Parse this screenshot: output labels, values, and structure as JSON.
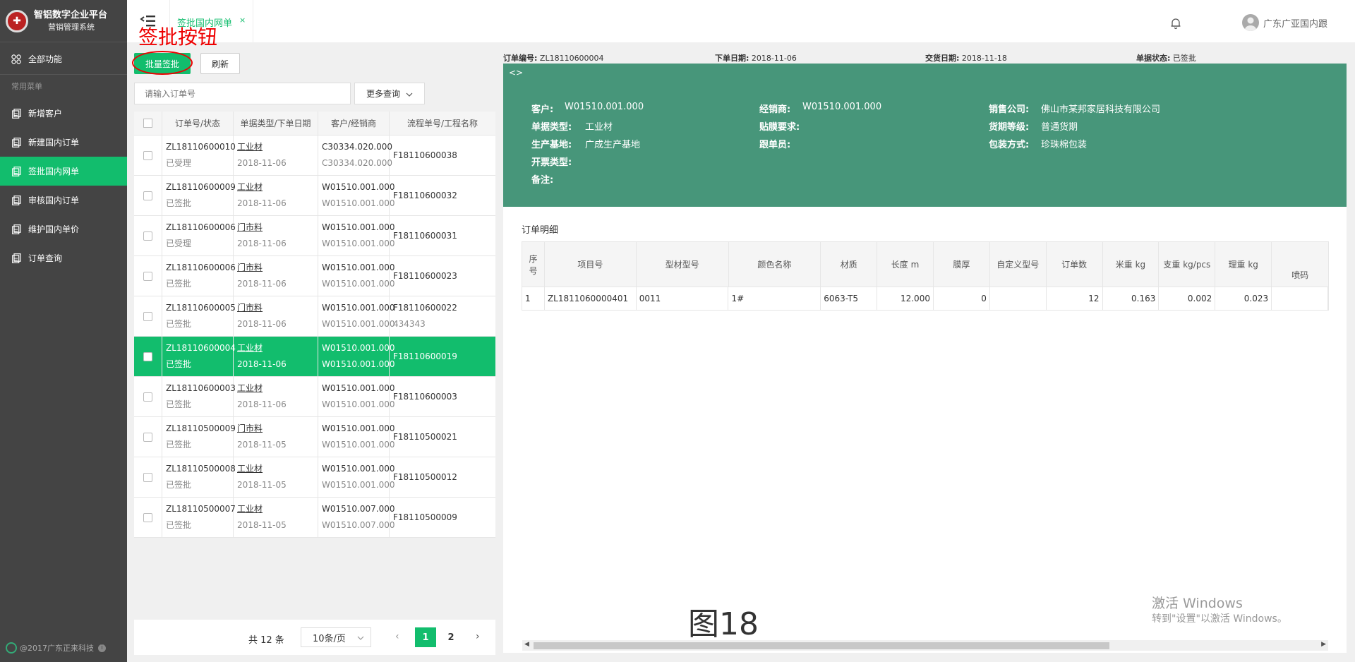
{
  "brand": {
    "title": "智铝数字企业平台",
    "subtitle": "营销管理系统",
    "logo_icon": "company-seal-logo"
  },
  "sidebar": {
    "all_label": "全部功能",
    "section_label": "常用菜单",
    "items": [
      {
        "label": "新增客户"
      },
      {
        "label": "新建国内订单"
      },
      {
        "label": "签批国内网单"
      },
      {
        "label": "审核国内订单"
      },
      {
        "label": "维护国内单价"
      },
      {
        "label": "订单查询"
      }
    ],
    "active_index": 2,
    "footer": "@2017广东正来科技"
  },
  "topbar": {
    "tab_label": "签批国内网单",
    "tab_close": "×",
    "user_name": "广东广亚国内跟"
  },
  "annotation": "签批按钮",
  "toolbar": {
    "batch_sign_label": "批量签批",
    "refresh_label": "刷新",
    "search_placeholder": "请输入订单号",
    "more_query_label": "更多查询"
  },
  "order_list": {
    "headers": [
      "订单号/状态",
      "单据类型/下单日期",
      "客户/经销商",
      "流程单号/工程名称"
    ],
    "rows": [
      {
        "order": "ZL18110600010",
        "status": "已受理",
        "type": "工业材",
        "date": "2018-11-06",
        "customer": "C30334.020.000",
        "dealer": "C30334.020.000",
        "flow": "F18110600038",
        "project": ""
      },
      {
        "order": "ZL18110600009",
        "status": "已签批",
        "type": "工业材",
        "date": "2018-11-06",
        "customer": "W01510.001.000",
        "dealer": "W01510.001.000",
        "flow": "F18110600032",
        "project": ""
      },
      {
        "order": "ZL18110600006",
        "status": "已受理",
        "type": "门市料",
        "date": "2018-11-06",
        "customer": "W01510.001.000",
        "dealer": "W01510.001.000",
        "flow": "F18110600031",
        "project": ""
      },
      {
        "order": "ZL18110600006",
        "status": "已签批",
        "type": "门市料",
        "date": "2018-11-06",
        "customer": "W01510.001.000",
        "dealer": "W01510.001.000",
        "flow": "F18110600023",
        "project": ""
      },
      {
        "order": "ZL18110600005",
        "status": "已签批",
        "type": "门市料",
        "date": "2018-11-06",
        "customer": "W01510.001.000",
        "dealer": "W01510.001.000",
        "flow": "F18110600022",
        "project": "434343"
      },
      {
        "order": "ZL18110600004",
        "status": "已签批",
        "type": "工业材",
        "date": "2018-11-06",
        "customer": "W01510.001.000",
        "dealer": "W01510.001.000",
        "flow": "F18110600019",
        "project": ""
      },
      {
        "order": "ZL18110600003",
        "status": "已签批",
        "type": "工业材",
        "date": "2018-11-06",
        "customer": "W01510.001.000",
        "dealer": "W01510.001.000",
        "flow": "F18110600003",
        "project": ""
      },
      {
        "order": "ZL18110500009",
        "status": "已签批",
        "type": "门市料",
        "date": "2018-11-05",
        "customer": "W01510.001.000",
        "dealer": "W01510.001.000",
        "flow": "F18110500021",
        "project": ""
      },
      {
        "order": "ZL18110500008",
        "status": "已签批",
        "type": "工业材",
        "date": "2018-11-05",
        "customer": "W01510.001.000",
        "dealer": "W01510.001.000",
        "flow": "F18110500012",
        "project": ""
      },
      {
        "order": "ZL18110500007",
        "status": "已签批",
        "type": "工业材",
        "date": "2018-11-05",
        "customer": "W01510.007.000",
        "dealer": "W01510.007.000",
        "flow": "F18110500009",
        "project": ""
      }
    ],
    "selected_index": 5
  },
  "pager": {
    "total": "共 12 条",
    "page_size": "10条/页",
    "pages": [
      "1",
      "2"
    ],
    "current": "1",
    "prev": "‹",
    "next": "›"
  },
  "detail_header": {
    "order_no_label": "订单编号:",
    "order_no": "ZL18110600004",
    "order_date_label": "下单日期:",
    "order_date": "2018-11-06",
    "delivery_label": "交货日期:",
    "delivery": "2018-11-18",
    "status_label": "单据状态:",
    "status": "已签批"
  },
  "green_panel": {
    "toggle": "<>",
    "customer_label": "客户:",
    "customer": "W01510.001.000",
    "dealer_label": "经销商:",
    "dealer": "W01510.001.000",
    "company_label": "销售公司:",
    "company": "佛山市某邦家居科技有限公司",
    "type_label": "单据类型:",
    "type": "工业材",
    "film_label": "贴膜要求:",
    "film": "",
    "grade_label": "货期等级:",
    "grade": "普通货期",
    "base_label": "生产基地:",
    "base": "广成生产基地",
    "follower_label": "跟单员:",
    "follower": "",
    "pack_label": "包装方式:",
    "pack": "珍珠棉包装",
    "invoice_label": "开票类型:",
    "invoice": "",
    "remark_label": "备注:",
    "remark": ""
  },
  "detail": {
    "title": "订单明细",
    "headers": [
      "序号",
      "项目号",
      "型材型号",
      "颜色名称",
      "材质",
      "长度 m",
      "膜厚",
      "自定义型号",
      "订单数",
      "米重 kg",
      "支重 kg/pcs",
      "理重 kg",
      "喷码"
    ],
    "row": [
      "1",
      "ZL1811060000401",
      "0011",
      "1#",
      "6063-T5",
      "12.000",
      "0",
      "",
      "12",
      "0.163",
      "0.002",
      "0.023",
      ""
    ]
  },
  "figure_label": "图18",
  "watermark": {
    "line1": "激活 Windows",
    "line2": "转到\"设置\"以激活 Windows。"
  },
  "colors": {
    "accent": "#12bd6d",
    "panel": "#47967a",
    "sidebar": "#444444",
    "annotation": "#e00000"
  }
}
